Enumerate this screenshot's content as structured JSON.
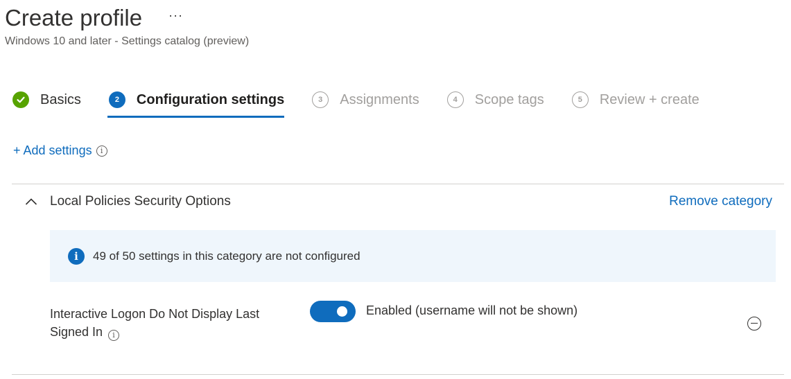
{
  "header": {
    "title": "Create profile",
    "more_label": "···",
    "subtitle": "Windows 10 and later - Settings catalog (preview)"
  },
  "steps": [
    {
      "number": "✓",
      "label": "Basics",
      "state": "done"
    },
    {
      "number": "2",
      "label": "Configuration settings",
      "state": "active"
    },
    {
      "number": "3",
      "label": "Assignments",
      "state": "todo"
    },
    {
      "number": "4",
      "label": "Scope tags",
      "state": "todo"
    },
    {
      "number": "5",
      "label": "Review + create",
      "state": "todo"
    }
  ],
  "add_settings": {
    "label": "+ Add settings",
    "info_glyph": "i"
  },
  "category": {
    "title": "Local Policies Security Options",
    "remove_label": "Remove category",
    "banner": {
      "icon": "i",
      "text": "49 of 50 settings in this category are not configured"
    },
    "setting": {
      "name": "Interactive Logon Do Not Display Last Signed In",
      "info_glyph": "i",
      "toggle_on": true,
      "value_label": "Enabled (username will not be shown)"
    }
  },
  "colors": {
    "accent": "#0f6cbd",
    "success": "#57a300",
    "banner_bg": "#eff6fc",
    "muted": "#a19f9d"
  }
}
